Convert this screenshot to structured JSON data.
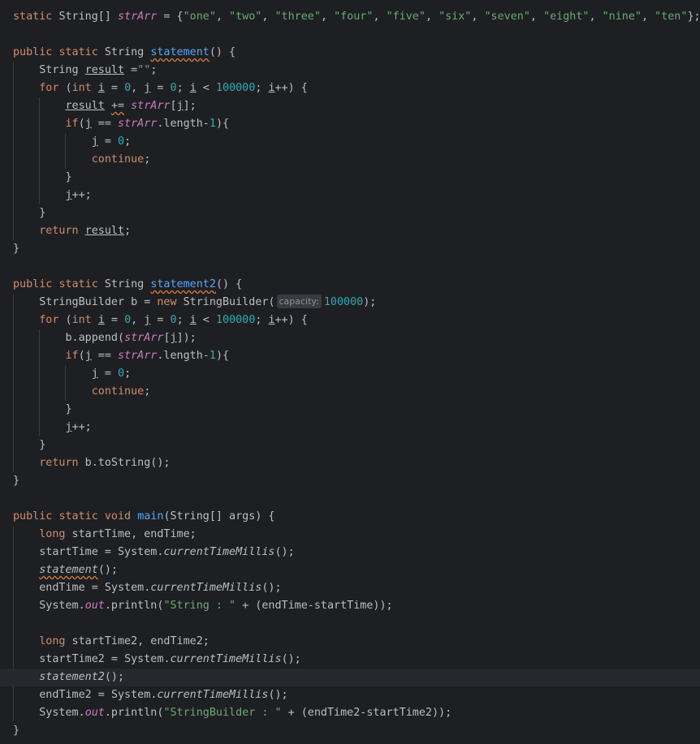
{
  "code": {
    "strArr_decl": {
      "kw_static": "static",
      "type": "String[]",
      "name": "strArr",
      "eq": " = {",
      "values": [
        "\"one\"",
        "\"two\"",
        "\"three\"",
        "\"four\"",
        "\"five\"",
        "\"six\"",
        "\"seven\"",
        "\"eight\"",
        "\"nine\"",
        "\"ten\""
      ],
      "close": "};"
    },
    "kw": {
      "public": "public",
      "static": "static",
      "for": "for",
      "int": "int",
      "if": "if",
      "continue": "continue",
      "return": "return",
      "new": "new",
      "void": "void",
      "long": "long"
    },
    "names": {
      "String": "String",
      "statement": "statement",
      "statement2": "statement2",
      "main": "main",
      "result": "result",
      "strArr": "strArr",
      "StringBuilder": "StringBuilder",
      "System": "System",
      "out": "out",
      "currentTimeMillis": "currentTimeMillis",
      "i": "i",
      "j": "j"
    },
    "numbers": {
      "zero": "0",
      "one": "1",
      "limit": "100000"
    },
    "strings": {
      "empty": "\"\"",
      "label1": "\"String : \"",
      "label2": "\"StringBuilder : \""
    },
    "hint": {
      "capacity": "capacity:"
    }
  }
}
